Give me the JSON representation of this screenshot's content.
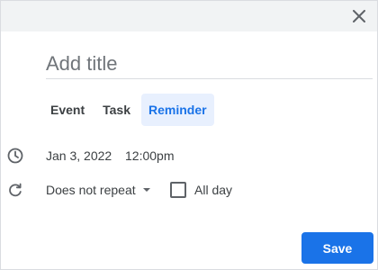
{
  "header": {
    "close_icon": "close-icon"
  },
  "title_field": {
    "placeholder": "Add title",
    "value": ""
  },
  "tabs": [
    {
      "label": "Event",
      "active": false
    },
    {
      "label": "Task",
      "active": false
    },
    {
      "label": "Reminder",
      "active": true
    }
  ],
  "datetime": {
    "icon": "clock-icon",
    "date": "Jan 3, 2022",
    "time": "12:00pm"
  },
  "repeat": {
    "icon": "repeat-icon",
    "value": "Does not repeat",
    "all_day_label": "All day",
    "all_day_checked": false
  },
  "footer": {
    "save_label": "Save"
  },
  "colors": {
    "accent": "#1a73e8",
    "active_tab_bg": "#e8f0fe",
    "topbar_bg": "#f1f3f4",
    "text": "#3c4043"
  }
}
